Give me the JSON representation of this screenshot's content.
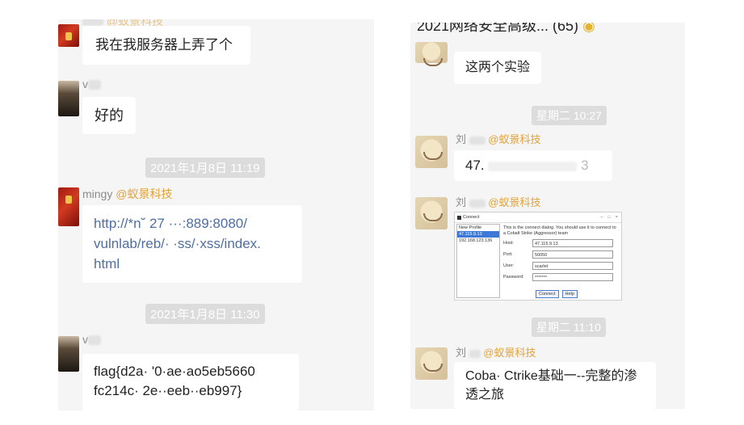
{
  "left_chat": {
    "msg1": {
      "name_partial": "··· ",
      "text": "我在我服务器上弄了个"
    },
    "msg2": {
      "text": "好的"
    },
    "time1": "2021年1月8日 11:19",
    "msg3": {
      "name": "mingy",
      "org": "@蚁景科技",
      "link_line1": "http://*n˘ 27 ···:889:8080/",
      "link_line2": "vulnlab/reb/· ·ss/·xss/index.",
      "link_line3": "html"
    },
    "time2": "2021年1月8日 11:30",
    "msg4": {
      "line1": "flag{d2a· '0·ae·ao5eb5660",
      "line2": "fc214c· 2e··eeb··eb997}"
    }
  },
  "right_chat": {
    "group_title": "2021网络安全高级... (65)",
    "msg1": {
      "text": "这两个实验"
    },
    "time1": "星期二 10:27",
    "msg2": {
      "name_prefix": "刘",
      "org": "@蚁景科技",
      "text_start": "47.",
      "text_end": "3"
    },
    "msg3": {
      "name_prefix": "刘",
      "org": "@蚁景科技",
      "screenshot": {
        "title": "Connect",
        "controls": [
          "–",
          "□",
          "×"
        ],
        "profiles": [
          "New Profile",
          "47.115.9.13",
          "192.168.123.136"
        ],
        "description": "This is the connect dialog. You should use it to connect to a Cobalt Strike (Aggressor) team",
        "fields": [
          {
            "label": "Host:",
            "value": "47.115.9.13"
          },
          {
            "label": "Port:",
            "value": "50050"
          },
          {
            "label": "User:",
            "value": "scarlet"
          },
          {
            "label": "Password:",
            "value": "*******"
          }
        ],
        "buttons": [
          "Connect",
          "Help"
        ]
      }
    },
    "time2": "星期二 11:10",
    "msg4": {
      "name_prefix": "刘",
      "org": "@蚁景科技",
      "line1": "Coba· Ctrike基础一--完整的渗",
      "line2": "透之旅"
    }
  }
}
